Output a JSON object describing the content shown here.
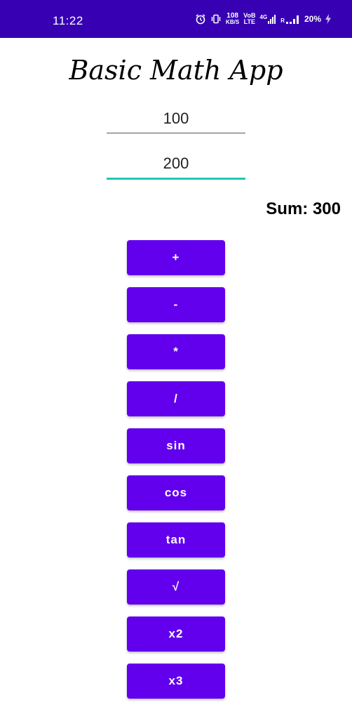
{
  "status_bar": {
    "time": "11:22",
    "net_speed_value": "108",
    "net_speed_unit": "KB/S",
    "volte_top": "VoB",
    "volte_bottom": "LTE",
    "network_type": "4G",
    "sim2_label": "R",
    "battery": "20%",
    "background_color": "#3700b3",
    "icons": [
      "alarm-icon",
      "vibrate-icon",
      "signal-icon",
      "battery-charging-icon"
    ]
  },
  "app": {
    "title": "Basic Math App",
    "input_1": {
      "value": "100"
    },
    "input_2": {
      "value": "200"
    },
    "result": "Sum: 300",
    "accent_color": "#26c6b0",
    "button_color": "#6200ee"
  },
  "buttons": [
    {
      "label": "+"
    },
    {
      "label": "-"
    },
    {
      "label": "*"
    },
    {
      "label": "/"
    },
    {
      "label": "sin"
    },
    {
      "label": "cos"
    },
    {
      "label": "tan"
    },
    {
      "label": "√"
    },
    {
      "label": "x2"
    },
    {
      "label": "x3"
    }
  ]
}
